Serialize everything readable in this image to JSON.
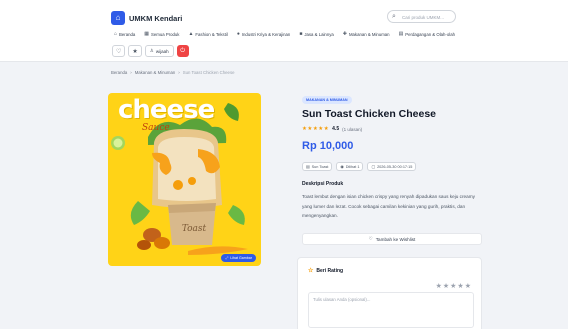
{
  "brand": {
    "logo_icon": "store-icon",
    "name": "UMKM Kendari"
  },
  "search": {
    "placeholder": "Cari produk UMKM..."
  },
  "nav": {
    "items": [
      {
        "icon": "home-icon",
        "label": "Beranda"
      },
      {
        "icon": "grid-icon",
        "label": "Semua Produk"
      },
      {
        "icon": "shirt-icon",
        "label": "Fashion & Tekstil"
      },
      {
        "icon": "palette-icon",
        "label": "Industri Kriya & Kerajinan"
      },
      {
        "icon": "briefcase-icon",
        "label": "Jasa & Lainnya"
      },
      {
        "icon": "utensils-icon",
        "label": "Makanan & Minuman"
      },
      {
        "icon": "leaf-icon",
        "label": "Perdagangan & Olah-olah"
      }
    ]
  },
  "toolbar": {
    "wishlist_icon": "heart-icon",
    "favorites_icon": "star-icon",
    "user_label": "wijaah",
    "user_icon": "user-icon",
    "logout_icon": "logout-icon"
  },
  "breadcrumb": {
    "home": "Beranda",
    "sep1": "›",
    "category": "Makanan & Minuman",
    "sep2": "›",
    "current": "Sun Toast Chicken Cheese"
  },
  "product_image": {
    "word": "cheese",
    "sub": "Sauce",
    "badge_label": "Lihat Gambar",
    "badge_icon": "zoom-icon"
  },
  "product": {
    "category_badge": "MAKANAN & MINUMAN",
    "title": "Sun Toast Chicken Cheese",
    "stars": "★★★★★",
    "rating_value": "4.5",
    "rating_count": "(1 ulasan)",
    "price": "Rp 10,000",
    "meta": [
      {
        "icon": "store-icon",
        "label": "Sun Toast"
      },
      {
        "icon": "eye-icon",
        "label": "Dilihat 1"
      },
      {
        "icon": "calendar-icon",
        "label": "2026-05-30 00:17:15"
      }
    ],
    "desc_title": "Deskripsi Produk",
    "description": "Toast lembut dengan isian chicken crispy yang renyah dipadukan saus keju creamy yang lumer dan lezat. Cocok sebagai camilan kekinian yang gurih, praktis, dan mengenyangkan.",
    "wishlist_label": "Tambah ke Wishlist",
    "wishlist_icon": "heart-icon"
  },
  "rating_form": {
    "title": "Beri Rating",
    "title_icon": "star-icon",
    "stars": "★★★★★",
    "placeholder": "Tulis ulasan Anda (opsional)..."
  }
}
